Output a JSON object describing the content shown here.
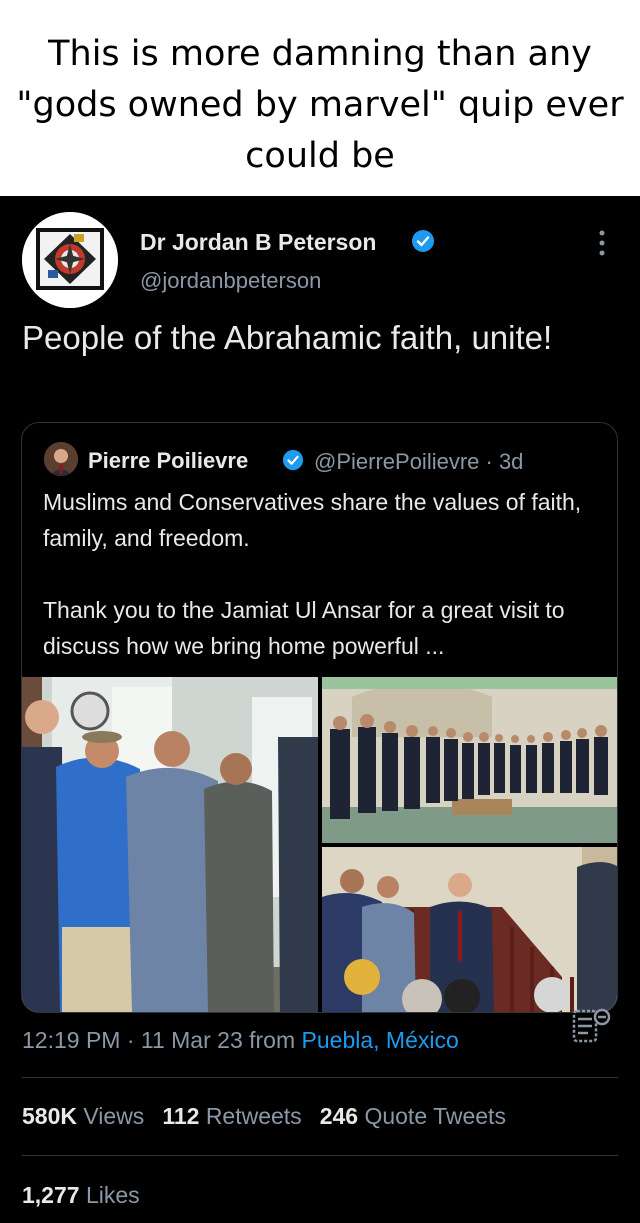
{
  "caption": "This is more damning than any \"gods owned by marvel\" quip ever could be",
  "author": {
    "name": "Dr Jordan B Peterson",
    "handle": "@jordanbpeterson"
  },
  "tweet_text": "People of the Abrahamic faith, unite!",
  "quoted": {
    "name": "Pierre Poilievre",
    "handle_time": "@PierrePoilievre · 3d",
    "paragraph1": "Muslims and Conservatives share the values of faith, family, and freedom.",
    "paragraph2": "Thank you to the Jamiat Ul Ansar for a great visit to discuss how we bring home powerful ..."
  },
  "meta": {
    "time": "12:19 PM · 11 Mar 23 from ",
    "location": "Puebla, México"
  },
  "stats": {
    "views_count": "580K",
    "views_label": "Views",
    "retweets_count": "112",
    "retweets_label": "Retweets",
    "quotes_count": "246",
    "quotes_label": "Quote Tweets",
    "likes_count": "1,277",
    "likes_label": "Likes"
  },
  "colors": {
    "background": "#000000",
    "text": "#e7e9ea",
    "secondary": "#8b98a5",
    "accent": "#1d9bf0",
    "border": "#2f3336"
  },
  "icons": [
    "verified-badge-icon",
    "more-options-icon",
    "analytics-icon"
  ]
}
